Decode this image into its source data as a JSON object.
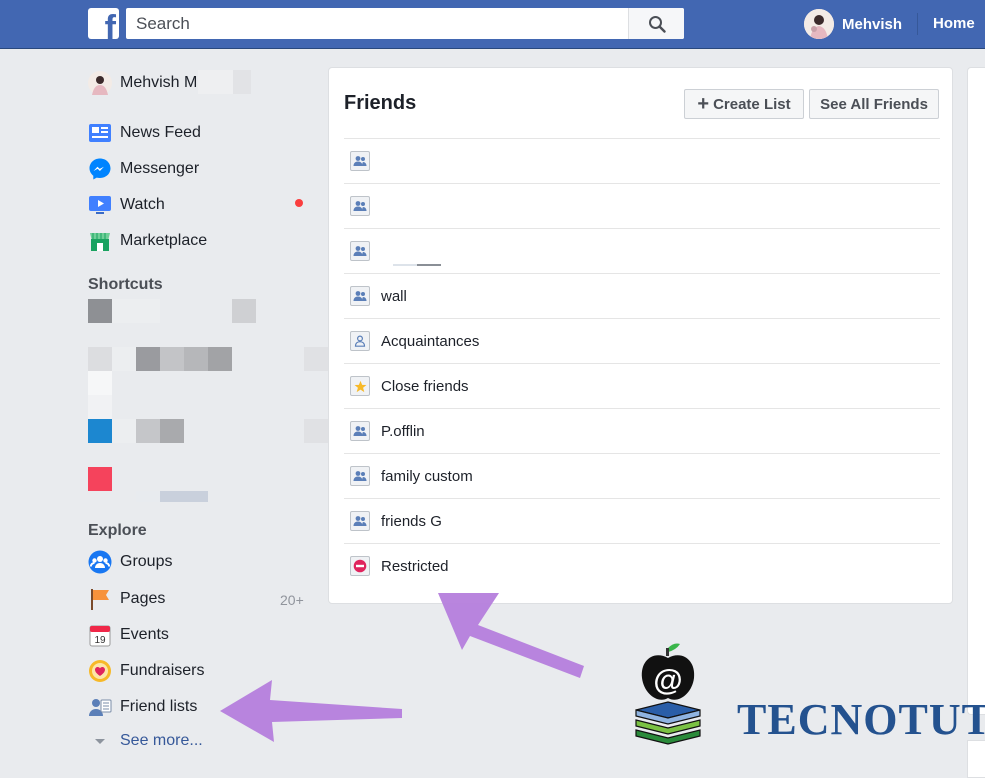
{
  "topbar": {
    "logo_letter": "f",
    "search_placeholder": "Search",
    "user_name": "Mehvish",
    "home_label": "Home"
  },
  "sidebar": {
    "profile_name": "Mehvish M",
    "items": [
      {
        "label": "News Feed",
        "icon": "news-feed-icon"
      },
      {
        "label": "Messenger",
        "icon": "messenger-icon"
      },
      {
        "label": "Watch",
        "icon": "watch-icon"
      },
      {
        "label": "Marketplace",
        "icon": "marketplace-icon"
      }
    ],
    "shortcuts_title": "Shortcuts",
    "explore_title": "Explore",
    "explore_items": [
      {
        "label": "Groups",
        "icon": "groups-icon"
      },
      {
        "label": "Pages",
        "icon": "pages-flag-icon",
        "count": "20+"
      },
      {
        "label": "Events",
        "icon": "events-calendar-icon"
      },
      {
        "label": "Fundraisers",
        "icon": "fundraisers-icon"
      },
      {
        "label": "Friend lists",
        "icon": "friend-lists-icon"
      }
    ],
    "see_more": "See more..."
  },
  "main": {
    "title": "Friends",
    "create_list": "Create List",
    "see_all_friends": "See All Friends",
    "lists": [
      {
        "label": "",
        "icon": "friends-list-icon"
      },
      {
        "label": "",
        "icon": "friends-list-icon"
      },
      {
        "label": "",
        "icon": "friends-list-icon"
      },
      {
        "label": "wall",
        "icon": "friends-list-icon"
      },
      {
        "label": "Acquaintances",
        "icon": "acquaintances-icon"
      },
      {
        "label": "Close friends",
        "icon": "star-icon"
      },
      {
        "label": "P.offlin",
        "icon": "friends-list-icon"
      },
      {
        "label": "family custom",
        "icon": "friends-list-icon"
      },
      {
        "label": "friends G",
        "icon": "friends-list-icon"
      },
      {
        "label": "Restricted",
        "icon": "restricted-icon"
      }
    ]
  },
  "watermark": {
    "text": "TECNOTUTO",
    "logo_glyph": "@"
  },
  "colors": {
    "brand_blue": "#4267b2",
    "page_bg": "#e9ebee",
    "link_blue": "#365899",
    "annotation_arrow": "#b57edc",
    "notification_red": "#fa3e3e"
  }
}
